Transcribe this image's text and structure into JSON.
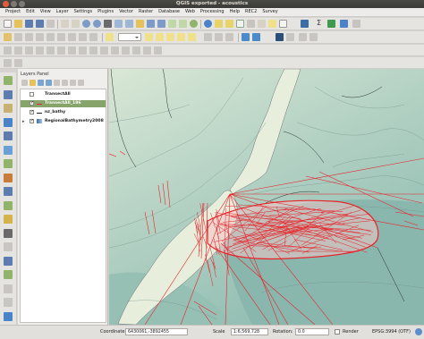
{
  "window": {
    "title": "QGIS exported - acoustics"
  },
  "menu": [
    "Project",
    "Edit",
    "View",
    "Layer",
    "Settings",
    "Plugins",
    "Vector",
    "Raster",
    "Database",
    "Web",
    "Processing",
    "Help",
    "REC2",
    "Survey"
  ],
  "layers_panel": {
    "title": "Layers Panel",
    "layers": [
      {
        "label": "TransectAll",
        "checked": false,
        "selected": false,
        "symbol": "none",
        "expander": ""
      },
      {
        "label": "TransectAll_186",
        "checked": true,
        "selected": true,
        "symbol": "line",
        "expander": ""
      },
      {
        "label": "nz_bathy",
        "checked": true,
        "selected": false,
        "symbol": "line-black",
        "expander": ""
      },
      {
        "label": "RegionalBathymetry2008",
        "checked": true,
        "selected": false,
        "symbol": "raster",
        "expander": "▸"
      }
    ]
  },
  "status": {
    "coordinate_label": "Coordinate:",
    "coordinate_value": "6430061,-3892455",
    "scale_label": "Scale",
    "scale_value": "1:6,569,728",
    "rotation_label": "Rotation:",
    "rotation_value": "0.0",
    "render_label": "Render",
    "crs_label": "EPSG:3994 (OTF)"
  },
  "colors": {
    "selected_layer": "#87a56a",
    "transect": "#e8232a",
    "land": "#e4ecd9",
    "sea_shallow": "#bcd7c8",
    "sea_deep": "#7fb0a8"
  }
}
